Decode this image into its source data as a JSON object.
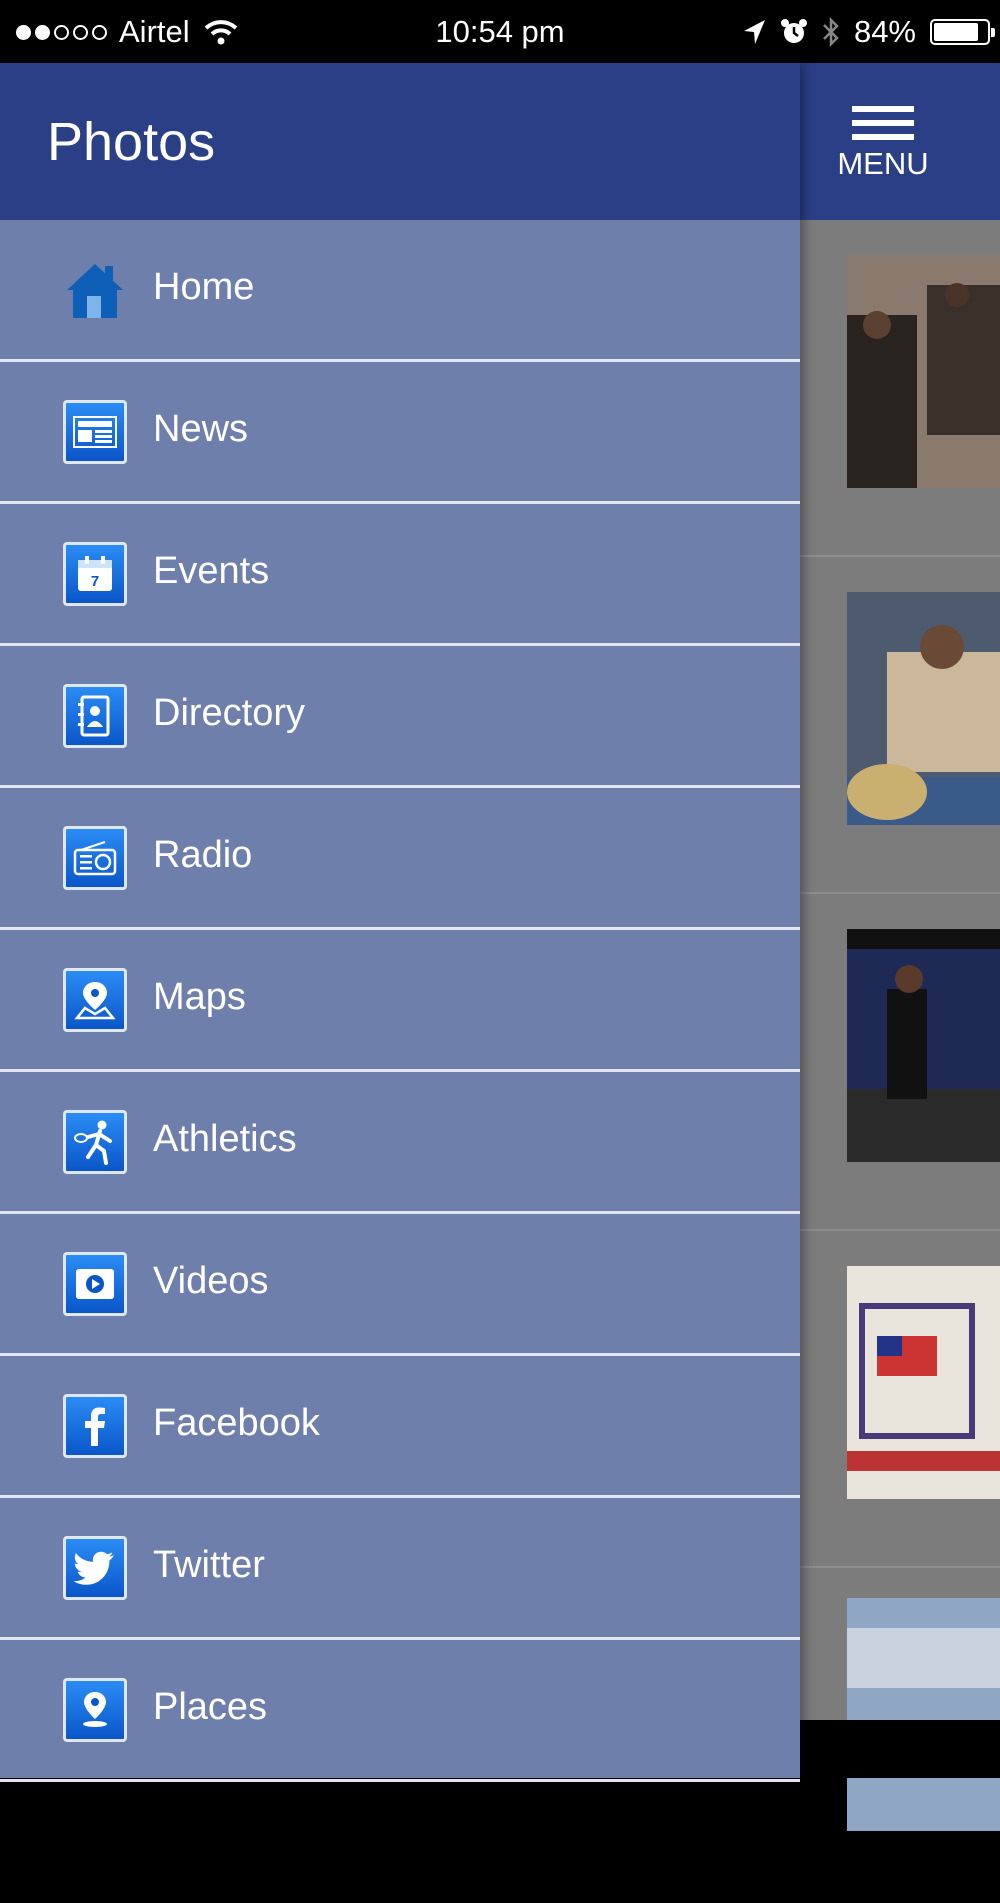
{
  "status_bar": {
    "carrier": "Airtel",
    "time": "10:54 pm",
    "battery": "84%",
    "battery_level": 0.84,
    "signal_bars_filled": 2,
    "signal_bars_total": 5
  },
  "header": {
    "menu_label": "MENU"
  },
  "drawer": {
    "title": "Photos",
    "items": [
      {
        "label": "Home",
        "icon": "home-icon"
      },
      {
        "label": "News",
        "icon": "newspaper-icon"
      },
      {
        "label": "Events",
        "icon": "calendar-icon"
      },
      {
        "label": "Directory",
        "icon": "contact-book-icon"
      },
      {
        "label": "Radio",
        "icon": "radio-icon"
      },
      {
        "label": "Maps",
        "icon": "map-pin-icon"
      },
      {
        "label": "Athletics",
        "icon": "tennis-player-icon"
      },
      {
        "label": "Videos",
        "icon": "video-play-icon"
      },
      {
        "label": "Facebook",
        "icon": "facebook-icon"
      },
      {
        "label": "Twitter",
        "icon": "twitter-bird-icon"
      },
      {
        "label": "Places",
        "icon": "place-pin-icon"
      }
    ]
  },
  "colors": {
    "header": "#2b3f86",
    "drawer_bg": "#6f7fab",
    "divider": "#e3e6f0",
    "icon_tile": "#1a6fe0"
  }
}
